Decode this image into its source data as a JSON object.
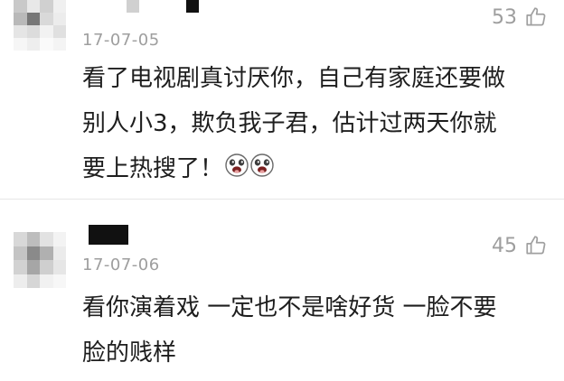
{
  "comments": [
    {
      "date": "17-07-05",
      "likes": "53",
      "lines": [
        "看了电视剧真讨厌你，自己有家庭还要做",
        "别人小3，欺负我子君，估计过两天你就",
        "要上热搜了！"
      ],
      "emoji": [
        "grinning-dog-emoji",
        "grinning-dog-emoji"
      ]
    },
    {
      "date": "17-07-06",
      "likes": "45",
      "lines": [
        "看你演着戏 一定也不是啥好货 一脸不要",
        "脸的贱样"
      ]
    }
  ],
  "icons": {
    "like": "thumbs-up-icon"
  },
  "colors": {
    "meta": "#9e9e9e",
    "text": "#1e1e1e",
    "divider": "#e6e6e6"
  }
}
